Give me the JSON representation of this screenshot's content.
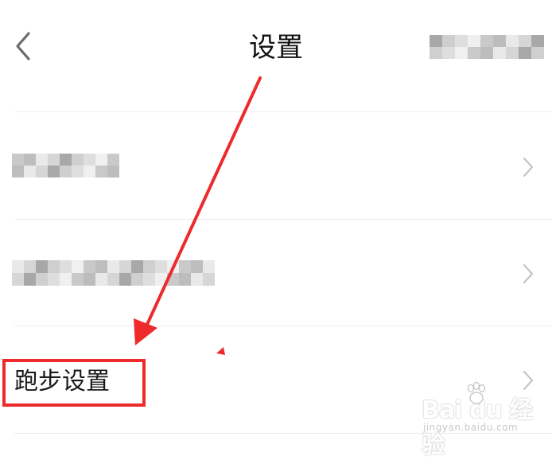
{
  "header": {
    "title": "设置",
    "back_icon": "chevron-left-icon"
  },
  "settings_list": {
    "items": [
      {
        "label": "",
        "label_obscured": true,
        "icon": "chevron-right-icon"
      },
      {
        "label": "",
        "label_obscured": true,
        "icon": "chevron-right-icon"
      },
      {
        "label": "跑步设置",
        "label_obscured": false,
        "icon": "chevron-right-icon"
      }
    ]
  },
  "annotation": {
    "arrow_color": "#ee2b2b",
    "box_color": "#ee2b2b"
  },
  "watermark": {
    "logo": "Bai du 经验",
    "url": "jingyan.baidu.com"
  },
  "colors": {
    "background": "#ffffff",
    "divider": "#ececec",
    "chevron": "#c4c4c4",
    "title": "#111111"
  }
}
